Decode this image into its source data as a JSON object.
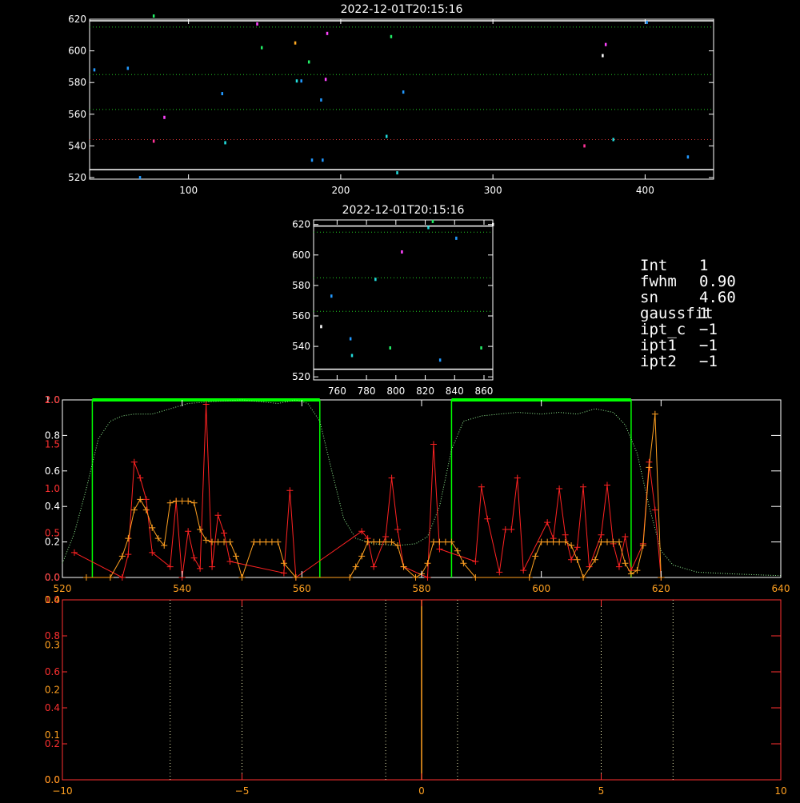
{
  "colors": {
    "background": "#000000",
    "frame": "#ffffff",
    "dotted_guide": "#22cc22",
    "red_guide": "#cc3333",
    "red_series": "#ff2222",
    "orange_series": "#ffa020",
    "green_window": "#00ff00",
    "green_profile": "#90ee90",
    "axis_red": "#ff3030",
    "axis_orange": "#ffa020"
  },
  "panel1": {
    "title": "2022-12-01T20:15:16"
  },
  "panel2": {
    "title": "2022-12-01T20:15:16"
  },
  "info_box": {
    "rows": [
      {
        "key": "Int",
        "value": "1"
      },
      {
        "key": "fwhm",
        "value": "0.90"
      },
      {
        "key": "sn",
        "value": "4.60"
      },
      {
        "key": "gaussfit",
        "value": "1"
      },
      {
        "key": "ipt_c",
        "value": "−1"
      },
      {
        "key": "ipt1",
        "value": "−1"
      },
      {
        "key": "ipt2",
        "value": "−1"
      }
    ]
  },
  "chart_data": [
    {
      "type": "scatter",
      "title": "2022-12-01T20:15:16",
      "xlim": [
        35,
        445
      ],
      "ylim": [
        519,
        620
      ],
      "xticks": [
        100,
        200,
        300,
        400
      ],
      "yticks": [
        520,
        540,
        560,
        580,
        600,
        620
      ],
      "hlines_dotted_green": [
        615,
        585,
        563
      ],
      "hlines_dotted_red": [
        544
      ],
      "hlines_solid_white": [
        619,
        525
      ],
      "points": [
        {
          "x": 38,
          "y": 588,
          "c": "#2299ff"
        },
        {
          "x": 60,
          "y": 589,
          "c": "#2299ff"
        },
        {
          "x": 68,
          "y": 520,
          "c": "#2299ff"
        },
        {
          "x": 77,
          "y": 622,
          "c": "#22ee66"
        },
        {
          "x": 77,
          "y": 543,
          "c": "#ff3399"
        },
        {
          "x": 84,
          "y": 558,
          "c": "#ff44ff"
        },
        {
          "x": 122,
          "y": 573,
          "c": "#2299ff"
        },
        {
          "x": 124,
          "y": 542,
          "c": "#22dddd"
        },
        {
          "x": 145,
          "y": 617,
          "c": "#ff44ff"
        },
        {
          "x": 148,
          "y": 602,
          "c": "#22ee66"
        },
        {
          "x": 170,
          "y": 605,
          "c": "#ffaa22"
        },
        {
          "x": 171,
          "y": 581,
          "c": "#22dddd"
        },
        {
          "x": 174,
          "y": 581,
          "c": "#2299ff"
        },
        {
          "x": 179,
          "y": 593,
          "c": "#22ee66"
        },
        {
          "x": 181,
          "y": 531,
          "c": "#2299ff"
        },
        {
          "x": 187,
          "y": 569,
          "c": "#2299ff"
        },
        {
          "x": 188,
          "y": 531,
          "c": "#2299ff"
        },
        {
          "x": 190,
          "y": 582,
          "c": "#ff44ff"
        },
        {
          "x": 191,
          "y": 611,
          "c": "#ff44ff"
        },
        {
          "x": 230,
          "y": 546,
          "c": "#22dddd"
        },
        {
          "x": 233,
          "y": 609,
          "c": "#22ee66"
        },
        {
          "x": 237,
          "y": 523,
          "c": "#22dddd"
        },
        {
          "x": 241,
          "y": 574,
          "c": "#2299ff"
        },
        {
          "x": 360,
          "y": 540,
          "c": "#ff3399"
        },
        {
          "x": 372,
          "y": 597,
          "c": "#ffffff"
        },
        {
          "x": 374,
          "y": 604,
          "c": "#ff44ff"
        },
        {
          "x": 379,
          "y": 544,
          "c": "#22dddd"
        },
        {
          "x": 401,
          "y": 618,
          "c": "#2299ff"
        },
        {
          "x": 428,
          "y": 533,
          "c": "#2299ff"
        }
      ]
    },
    {
      "type": "scatter",
      "title": "2022-12-01T20:15:16",
      "xlim": [
        744,
        866
      ],
      "ylim": [
        518,
        623
      ],
      "xticks": [
        760,
        780,
        800,
        820,
        840,
        860
      ],
      "yticks": [
        520,
        540,
        560,
        580,
        600,
        620
      ],
      "hlines_dotted_green": [
        615,
        585,
        563
      ],
      "hlines_solid_white": [
        619,
        525
      ],
      "points": [
        {
          "x": 749,
          "y": 553,
          "c": "#ffffff"
        },
        {
          "x": 756,
          "y": 573,
          "c": "#2299ff"
        },
        {
          "x": 769,
          "y": 545,
          "c": "#2299ff"
        },
        {
          "x": 770,
          "y": 534,
          "c": "#22dddd"
        },
        {
          "x": 786,
          "y": 584,
          "c": "#22dddd"
        },
        {
          "x": 796,
          "y": 539,
          "c": "#22ee66"
        },
        {
          "x": 804,
          "y": 602,
          "c": "#ff44ff"
        },
        {
          "x": 822,
          "y": 618,
          "c": "#22dddd"
        },
        {
          "x": 825,
          "y": 622,
          "c": "#22ee66"
        },
        {
          "x": 830,
          "y": 531,
          "c": "#2299ff"
        },
        {
          "x": 841,
          "y": 611,
          "c": "#2299ff"
        },
        {
          "x": 858,
          "y": 539,
          "c": "#22ee66"
        },
        {
          "x": 866,
          "y": 620,
          "c": "#ffffff"
        }
      ]
    },
    {
      "type": "line",
      "xlim": [
        520,
        640
      ],
      "xticks": [
        520,
        540,
        560,
        580,
        600,
        620,
        640
      ],
      "y_axis_white": {
        "range": [
          0,
          1.0
        ],
        "ticks": [
          "0.0",
          "0.2",
          "0.4",
          "0.6",
          "0.8",
          "1.0"
        ]
      },
      "y_axis_red": {
        "range": [
          0,
          2.0
        ],
        "ticks": [
          "0.0",
          "0.5",
          "1.0",
          "1.5",
          "2.0"
        ]
      },
      "green_windows": [
        [
          525,
          563
        ],
        [
          585,
          615
        ]
      ],
      "profile_green": [
        [
          520,
          0.08
        ],
        [
          522,
          0.25
        ],
        [
          524,
          0.5
        ],
        [
          526,
          0.78
        ],
        [
          528,
          0.88
        ],
        [
          530,
          0.91
        ],
        [
          532,
          0.92
        ],
        [
          535,
          0.92
        ],
        [
          538,
          0.95
        ],
        [
          541,
          0.98
        ],
        [
          545,
          0.99
        ],
        [
          550,
          1.0
        ],
        [
          553,
          0.99
        ],
        [
          556,
          0.98
        ],
        [
          559,
          1.0
        ],
        [
          561,
          0.98
        ],
        [
          563,
          0.88
        ],
        [
          565,
          0.6
        ],
        [
          567,
          0.33
        ],
        [
          569,
          0.22
        ],
        [
          572,
          0.19
        ],
        [
          576,
          0.18
        ],
        [
          579,
          0.19
        ],
        [
          581,
          0.23
        ],
        [
          583,
          0.4
        ],
        [
          585,
          0.72
        ],
        [
          587,
          0.88
        ],
        [
          590,
          0.91
        ],
        [
          593,
          0.92
        ],
        [
          596,
          0.93
        ],
        [
          600,
          0.92
        ],
        [
          603,
          0.93
        ],
        [
          606,
          0.92
        ],
        [
          609,
          0.95
        ],
        [
          612,
          0.93
        ],
        [
          614,
          0.86
        ],
        [
          616,
          0.7
        ],
        [
          618,
          0.4
        ],
        [
          620,
          0.15
        ],
        [
          622,
          0.07
        ],
        [
          626,
          0.03
        ],
        [
          632,
          0.02
        ],
        [
          640,
          0.01
        ]
      ],
      "series_red": [
        [
          522,
          0.28
        ],
        [
          530,
          0.0
        ],
        [
          531,
          0.26
        ],
        [
          532,
          1.3
        ],
        [
          533,
          1.12
        ],
        [
          534,
          0.88
        ],
        [
          535,
          0.28
        ],
        [
          538,
          0.12
        ],
        [
          539,
          0.86
        ],
        [
          540,
          0.0
        ],
        [
          541,
          0.52
        ],
        [
          542,
          0.22
        ],
        [
          543,
          0.1
        ],
        [
          544,
          1.95
        ],
        [
          545,
          0.12
        ],
        [
          546,
          0.7
        ],
        [
          547,
          0.5
        ],
        [
          548,
          0.18
        ],
        [
          557,
          0.05
        ],
        [
          558,
          0.98
        ],
        [
          559,
          0.0
        ],
        [
          570,
          0.52
        ],
        [
          571,
          0.44
        ],
        [
          572,
          0.12
        ],
        [
          574,
          0.46
        ],
        [
          575,
          1.12
        ],
        [
          576,
          0.54
        ],
        [
          577,
          0.12
        ],
        [
          581,
          0.0
        ],
        [
          582,
          1.5
        ],
        [
          583,
          0.32
        ],
        [
          589,
          0.18
        ],
        [
          590,
          1.02
        ],
        [
          591,
          0.66
        ],
        [
          593,
          0.06
        ],
        [
          594,
          0.54
        ],
        [
          595,
          0.54
        ],
        [
          596,
          1.12
        ],
        [
          597,
          0.08
        ],
        [
          601,
          0.62
        ],
        [
          602,
          0.44
        ],
        [
          603,
          1.0
        ],
        [
          604,
          0.48
        ],
        [
          605,
          0.2
        ],
        [
          606,
          0.34
        ],
        [
          607,
          1.02
        ],
        [
          608,
          0.12
        ],
        [
          610,
          0.48
        ],
        [
          611,
          1.04
        ],
        [
          612,
          0.38
        ],
        [
          613,
          0.12
        ],
        [
          614,
          0.46
        ],
        [
          615,
          0.08
        ],
        [
          617,
          0.38
        ],
        [
          618,
          1.3
        ],
        [
          619,
          0.76
        ],
        [
          620,
          0.0
        ]
      ],
      "series_orange": [
        [
          524,
          0.0
        ],
        [
          528,
          0.0
        ],
        [
          530,
          0.12
        ],
        [
          531,
          0.22
        ],
        [
          532,
          0.38
        ],
        [
          533,
          0.44
        ],
        [
          534,
          0.38
        ],
        [
          535,
          0.28
        ],
        [
          536,
          0.22
        ],
        [
          537,
          0.18
        ],
        [
          538,
          0.42
        ],
        [
          539,
          0.43
        ],
        [
          540,
          0.43
        ],
        [
          541,
          0.43
        ],
        [
          542,
          0.42
        ],
        [
          543,
          0.27
        ],
        [
          544,
          0.21
        ],
        [
          545,
          0.2
        ],
        [
          546,
          0.2
        ],
        [
          547,
          0.2
        ],
        [
          548,
          0.2
        ],
        [
          549,
          0.12
        ],
        [
          550,
          0.0
        ],
        [
          552,
          0.2
        ],
        [
          553,
          0.2
        ],
        [
          554,
          0.2
        ],
        [
          555,
          0.2
        ],
        [
          556,
          0.2
        ],
        [
          557,
          0.08
        ],
        [
          559,
          0.0
        ],
        [
          568,
          0.0
        ],
        [
          569,
          0.06
        ],
        [
          570,
          0.12
        ],
        [
          571,
          0.2
        ],
        [
          572,
          0.2
        ],
        [
          573,
          0.2
        ],
        [
          574,
          0.2
        ],
        [
          575,
          0.2
        ],
        [
          576,
          0.18
        ],
        [
          577,
          0.06
        ],
        [
          579,
          0.0
        ],
        [
          580,
          0.02
        ],
        [
          581,
          0.08
        ],
        [
          582,
          0.2
        ],
        [
          583,
          0.2
        ],
        [
          584,
          0.2
        ],
        [
          585,
          0.2
        ],
        [
          586,
          0.15
        ],
        [
          587,
          0.08
        ],
        [
          589,
          0.0
        ],
        [
          598,
          0.0
        ],
        [
          599,
          0.12
        ],
        [
          600,
          0.2
        ],
        [
          601,
          0.2
        ],
        [
          602,
          0.2
        ],
        [
          603,
          0.2
        ],
        [
          604,
          0.2
        ],
        [
          605,
          0.18
        ],
        [
          606,
          0.1
        ],
        [
          607,
          0.0
        ],
        [
          609,
          0.1
        ],
        [
          610,
          0.2
        ],
        [
          611,
          0.2
        ],
        [
          612,
          0.2
        ],
        [
          613,
          0.2
        ],
        [
          614,
          0.08
        ],
        [
          615,
          0.02
        ],
        [
          616,
          0.04
        ],
        [
          617,
          0.18
        ],
        [
          618,
          0.62
        ],
        [
          619,
          0.92
        ],
        [
          620,
          0.0
        ]
      ]
    },
    {
      "type": "line",
      "xlim": [
        -10,
        10
      ],
      "xticks": [
        "−10",
        "−5",
        "0",
        "5",
        "10"
      ],
      "xtick_values": [
        -10,
        -5,
        0,
        5,
        10
      ],
      "y_axis_white": {
        "range": [
          0,
          1.0
        ],
        "ticks": [
          "0.0",
          "0.2",
          "0.4",
          "0.6",
          "0.8",
          "1.0"
        ]
      },
      "y_axis_orange": {
        "range": [
          0,
          0.4
        ],
        "ticks": [
          "0.0",
          "0.1",
          "0.2",
          "0.3",
          "0.4"
        ]
      },
      "vlines_dotted_white": [
        -7,
        -5,
        -1,
        1,
        5,
        7
      ],
      "vline_solid_orange": [
        0
      ]
    }
  ]
}
